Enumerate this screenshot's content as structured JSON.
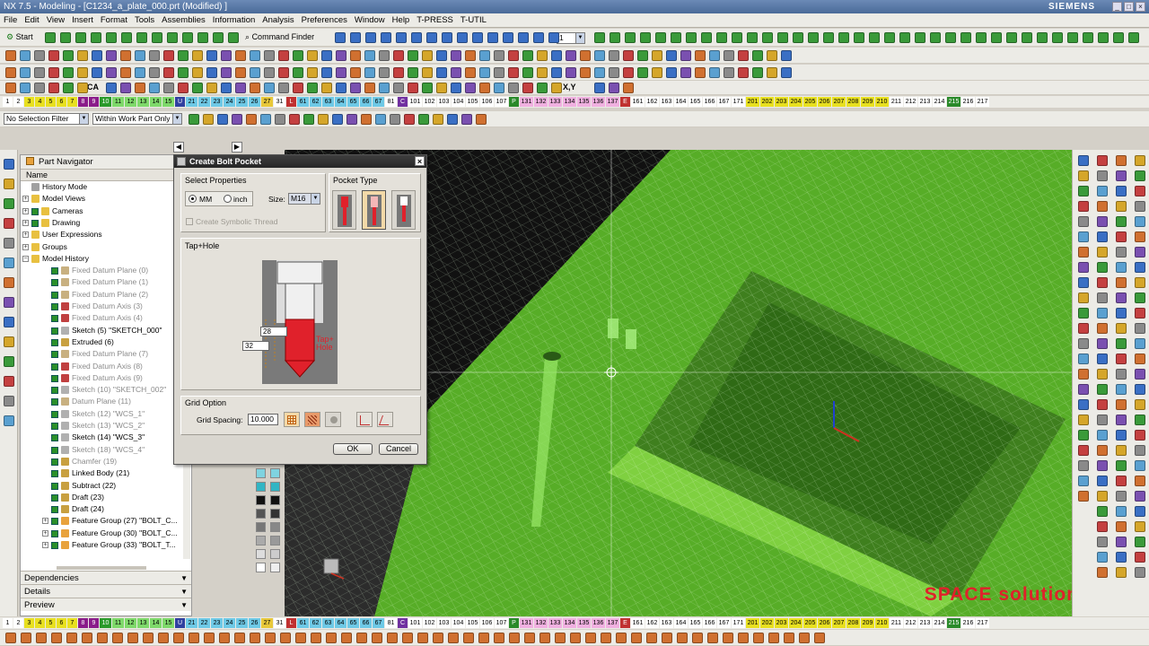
{
  "window": {
    "title": "NX 7.5 - Modeling - [C1234_a_plate_000.prt (Modified) ]",
    "brand": "SIEMENS"
  },
  "menu": [
    "File",
    "Edit",
    "View",
    "Insert",
    "Format",
    "Tools",
    "Assemblies",
    "Information",
    "Analysis",
    "Preferences",
    "Window",
    "Help",
    "T-PRESS",
    "T-UTIL"
  ],
  "toolbar": {
    "start_label": "Start",
    "command_finder_label": "Command Finder",
    "layer_value": "1",
    "ca_label": "CA",
    "xy_label": "X,Y"
  },
  "layer_strip": {
    "top": [
      {
        "t": "1",
        "c": "#ffffff"
      },
      {
        "t": "2",
        "c": "#ffffff"
      },
      {
        "t": "3",
        "c": "#e8e020"
      },
      {
        "t": "4",
        "c": "#e8e020"
      },
      {
        "t": "5",
        "c": "#e8e020"
      },
      {
        "t": "6",
        "c": "#e8e020"
      },
      {
        "t": "7",
        "c": "#e8e020"
      },
      {
        "t": "8",
        "c": "#8a1c8a"
      },
      {
        "t": "9",
        "c": "#8a1c8a"
      },
      {
        "t": "10",
        "c": "#2a9a2a"
      },
      {
        "t": "11",
        "c": "#7ed96a"
      },
      {
        "t": "12",
        "c": "#7ed96a"
      },
      {
        "t": "13",
        "c": "#7ed96a"
      },
      {
        "t": "14",
        "c": "#7ed96a"
      },
      {
        "t": "15",
        "c": "#7ed96a"
      },
      {
        "t": "U",
        "c": "#3040a0"
      },
      {
        "t": "21",
        "c": "#6ec9e6"
      },
      {
        "t": "22",
        "c": "#6ec9e6"
      },
      {
        "t": "23",
        "c": "#6ec9e6"
      },
      {
        "t": "24",
        "c": "#6ec9e6"
      },
      {
        "t": "25",
        "c": "#6ec9e6"
      },
      {
        "t": "26",
        "c": "#6ec9e6"
      },
      {
        "t": "27",
        "c": "#e8c83a"
      },
      {
        "t": "31",
        "c": "#ffffff"
      },
      {
        "t": "L",
        "c": "#c03030"
      },
      {
        "t": "61",
        "c": "#6ec9e6"
      },
      {
        "t": "62",
        "c": "#6ec9e6"
      },
      {
        "t": "63",
        "c": "#6ec9e6"
      },
      {
        "t": "64",
        "c": "#6ec9e6"
      },
      {
        "t": "65",
        "c": "#6ec9e6"
      },
      {
        "t": "66",
        "c": "#6ec9e6"
      },
      {
        "t": "67",
        "c": "#6ec9e6"
      },
      {
        "t": "81",
        "c": "#ffffff"
      },
      {
        "t": "C",
        "c": "#7030a0"
      },
      {
        "t": "101",
        "c": "#ffffff"
      },
      {
        "t": "102",
        "c": "#ffffff"
      },
      {
        "t": "103",
        "c": "#ffffff"
      },
      {
        "t": "104",
        "c": "#ffffff"
      },
      {
        "t": "105",
        "c": "#ffffff"
      },
      {
        "t": "106",
        "c": "#ffffff"
      },
      {
        "t": "107",
        "c": "#ffffff"
      },
      {
        "t": "P",
        "c": "#2a8a2a"
      },
      {
        "t": "131",
        "c": "#f0b0e0"
      },
      {
        "t": "132",
        "c": "#f0b0e0"
      },
      {
        "t": "133",
        "c": "#f0b0e0"
      },
      {
        "t": "134",
        "c": "#f0b0e0"
      },
      {
        "t": "135",
        "c": "#f0b0e0"
      },
      {
        "t": "136",
        "c": "#f0b0e0"
      },
      {
        "t": "137",
        "c": "#f0b0e0"
      },
      {
        "t": "E",
        "c": "#c03030"
      },
      {
        "t": "161",
        "c": "#ffffff"
      },
      {
        "t": "162",
        "c": "#ffffff"
      },
      {
        "t": "163",
        "c": "#ffffff"
      },
      {
        "t": "164",
        "c": "#ffffff"
      },
      {
        "t": "165",
        "c": "#ffffff"
      },
      {
        "t": "166",
        "c": "#ffffff"
      },
      {
        "t": "167",
        "c": "#ffffff"
      },
      {
        "t": "171",
        "c": "#ffffff"
      },
      {
        "t": "201",
        "c": "#e8e020"
      },
      {
        "t": "202",
        "c": "#e8e020"
      },
      {
        "t": "203",
        "c": "#e8e020"
      },
      {
        "t": "204",
        "c": "#e8e020"
      },
      {
        "t": "205",
        "c": "#e8e020"
      },
      {
        "t": "206",
        "c": "#e8e020"
      },
      {
        "t": "207",
        "c": "#e8e020"
      },
      {
        "t": "208",
        "c": "#e8e020"
      },
      {
        "t": "209",
        "c": "#e8e020"
      },
      {
        "t": "210",
        "c": "#e8e020"
      },
      {
        "t": "211",
        "c": "#ffffff"
      },
      {
        "t": "212",
        "c": "#ffffff"
      },
      {
        "t": "213",
        "c": "#ffffff"
      },
      {
        "t": "214",
        "c": "#ffffff"
      },
      {
        "t": "215",
        "c": "#2a8a2a"
      },
      {
        "t": "216",
        "c": "#ffffff"
      },
      {
        "t": "217",
        "c": "#ffffff"
      }
    ],
    "bottom": [
      {
        "t": "1",
        "c": "#ffffff"
      },
      {
        "t": "2",
        "c": "#ffffff"
      },
      {
        "t": "3",
        "c": "#e8e020"
      },
      {
        "t": "4",
        "c": "#e8e020"
      },
      {
        "t": "5",
        "c": "#e8e020"
      },
      {
        "t": "6",
        "c": "#e8e020"
      },
      {
        "t": "7",
        "c": "#e8e020"
      },
      {
        "t": "8",
        "c": "#8a1c8a"
      },
      {
        "t": "9",
        "c": "#8a1c8a"
      },
      {
        "t": "10",
        "c": "#2a9a2a"
      },
      {
        "t": "11",
        "c": "#7ed96a"
      },
      {
        "t": "12",
        "c": "#7ed96a"
      },
      {
        "t": "13",
        "c": "#7ed96a"
      },
      {
        "t": "14",
        "c": "#7ed96a"
      },
      {
        "t": "15",
        "c": "#7ed96a"
      },
      {
        "t": "U",
        "c": "#3040a0"
      },
      {
        "t": "21",
        "c": "#6ec9e6"
      },
      {
        "t": "22",
        "c": "#6ec9e6"
      },
      {
        "t": "23",
        "c": "#6ec9e6"
      },
      {
        "t": "24",
        "c": "#6ec9e6"
      },
      {
        "t": "25",
        "c": "#6ec9e6"
      },
      {
        "t": "26",
        "c": "#6ec9e6"
      },
      {
        "t": "27",
        "c": "#e8c83a"
      },
      {
        "t": "31",
        "c": "#ffffff"
      },
      {
        "t": "L",
        "c": "#c03030"
      },
      {
        "t": "61",
        "c": "#6ec9e6"
      },
      {
        "t": "62",
        "c": "#6ec9e6"
      },
      {
        "t": "63",
        "c": "#6ec9e6"
      },
      {
        "t": "64",
        "c": "#6ec9e6"
      },
      {
        "t": "65",
        "c": "#6ec9e6"
      },
      {
        "t": "66",
        "c": "#6ec9e6"
      },
      {
        "t": "67",
        "c": "#6ec9e6"
      },
      {
        "t": "81",
        "c": "#ffffff"
      },
      {
        "t": "C",
        "c": "#7030a0"
      },
      {
        "t": "101",
        "c": "#ffffff"
      },
      {
        "t": "102",
        "c": "#ffffff"
      },
      {
        "t": "103",
        "c": "#ffffff"
      },
      {
        "t": "104",
        "c": "#ffffff"
      },
      {
        "t": "105",
        "c": "#ffffff"
      },
      {
        "t": "106",
        "c": "#ffffff"
      },
      {
        "t": "107",
        "c": "#ffffff"
      },
      {
        "t": "P",
        "c": "#2a8a2a"
      },
      {
        "t": "131",
        "c": "#f0b0e0"
      },
      {
        "t": "132",
        "c": "#f0b0e0"
      },
      {
        "t": "133",
        "c": "#f0b0e0"
      },
      {
        "t": "134",
        "c": "#f0b0e0"
      },
      {
        "t": "135",
        "c": "#f0b0e0"
      },
      {
        "t": "136",
        "c": "#f0b0e0"
      },
      {
        "t": "137",
        "c": "#f0b0e0"
      },
      {
        "t": "E",
        "c": "#c03030"
      },
      {
        "t": "161",
        "c": "#ffffff"
      },
      {
        "t": "162",
        "c": "#ffffff"
      },
      {
        "t": "163",
        "c": "#ffffff"
      },
      {
        "t": "164",
        "c": "#ffffff"
      },
      {
        "t": "165",
        "c": "#ffffff"
      },
      {
        "t": "166",
        "c": "#ffffff"
      },
      {
        "t": "167",
        "c": "#ffffff"
      },
      {
        "t": "171",
        "c": "#ffffff"
      },
      {
        "t": "201",
        "c": "#e8e020"
      },
      {
        "t": "202",
        "c": "#e8e020"
      },
      {
        "t": "203",
        "c": "#e8e020"
      },
      {
        "t": "204",
        "c": "#e8e020"
      },
      {
        "t": "205",
        "c": "#e8e020"
      },
      {
        "t": "206",
        "c": "#e8e020"
      },
      {
        "t": "207",
        "c": "#e8e020"
      },
      {
        "t": "208",
        "c": "#e8e020"
      },
      {
        "t": "209",
        "c": "#e8e020"
      },
      {
        "t": "210",
        "c": "#e8e020"
      },
      {
        "t": "211",
        "c": "#ffffff"
      },
      {
        "t": "212",
        "c": "#ffffff"
      },
      {
        "t": "213",
        "c": "#ffffff"
      },
      {
        "t": "214",
        "c": "#ffffff"
      },
      {
        "t": "215",
        "c": "#2a8a2a"
      },
      {
        "t": "216",
        "c": "#ffffff"
      },
      {
        "t": "217",
        "c": "#ffffff"
      }
    ]
  },
  "selection": {
    "filter": "No Selection Filter",
    "scope": "Within Work Part Only"
  },
  "navigator": {
    "title": "Part Navigator",
    "column": "Name",
    "items": [
      {
        "label": "History Mode",
        "kind": "mode",
        "dim": false,
        "checked": false
      },
      {
        "label": "Model Views",
        "kind": "folder",
        "dim": false,
        "checked": false,
        "expander": "+"
      },
      {
        "label": "Cameras",
        "kind": "folder",
        "dim": false,
        "checked": true,
        "expander": "+"
      },
      {
        "label": "Drawing",
        "kind": "folder",
        "dim": false,
        "checked": true,
        "expander": "+"
      },
      {
        "label": "User Expressions",
        "kind": "folder",
        "dim": false,
        "checked": false,
        "expander": "+"
      },
      {
        "label": "Groups",
        "kind": "folder",
        "dim": false,
        "checked": false,
        "expander": "+"
      },
      {
        "label": "Model History",
        "kind": "folder",
        "dim": false,
        "checked": false,
        "expander": "−"
      },
      {
        "label": "Fixed Datum Plane (0)",
        "kind": "datum",
        "dim": true,
        "checked": true
      },
      {
        "label": "Fixed Datum Plane (1)",
        "kind": "datum",
        "dim": true,
        "checked": true
      },
      {
        "label": "Fixed Datum Plane (2)",
        "kind": "datum",
        "dim": true,
        "checked": true
      },
      {
        "label": "Fixed Datum Axis (3)",
        "kind": "axis",
        "dim": true,
        "checked": true
      },
      {
        "label": "Fixed Datum Axis (4)",
        "kind": "axis",
        "dim": true,
        "checked": true
      },
      {
        "label": "Sketch (5) \"SKETCH_000\"",
        "kind": "sketch",
        "dim": false,
        "checked": true
      },
      {
        "label": "Extruded (6)",
        "kind": "feature",
        "dim": false,
        "checked": true
      },
      {
        "label": "Fixed Datum Plane (7)",
        "kind": "datum",
        "dim": true,
        "checked": true
      },
      {
        "label": "Fixed Datum Axis (8)",
        "kind": "axis",
        "dim": true,
        "checked": true
      },
      {
        "label": "Fixed Datum Axis (9)",
        "kind": "axis",
        "dim": true,
        "checked": true
      },
      {
        "label": "Sketch (10) \"SKETCH_002\"",
        "kind": "sketch",
        "dim": true,
        "checked": true
      },
      {
        "label": "Datum Plane (11)",
        "kind": "datum",
        "dim": true,
        "checked": true
      },
      {
        "label": "Sketch (12) \"WCS_1\"",
        "kind": "sketch",
        "dim": true,
        "checked": true
      },
      {
        "label": "Sketch (13) \"WCS_2\"",
        "kind": "sketch",
        "dim": true,
        "checked": true
      },
      {
        "label": "Sketch (14) \"WCS_3\"",
        "kind": "sketch",
        "dim": false,
        "checked": true
      },
      {
        "label": "Sketch (18) \"WCS_4\"",
        "kind": "sketch",
        "dim": true,
        "checked": true
      },
      {
        "label": "Chamfer (19)",
        "kind": "feature",
        "dim": true,
        "checked": true
      },
      {
        "label": "Linked Body (21)",
        "kind": "feature",
        "dim": false,
        "checked": true
      },
      {
        "label": "Subtract (22)",
        "kind": "feature",
        "dim": false,
        "checked": true
      },
      {
        "label": "Draft (23)",
        "kind": "feature",
        "dim": false,
        "checked": true
      },
      {
        "label": "Draft (24)",
        "kind": "feature",
        "dim": false,
        "checked": true
      },
      {
        "label": "Feature Group (27) \"BOLT_C...",
        "kind": "group",
        "dim": false,
        "checked": true,
        "expander": "+"
      },
      {
        "label": "Feature Group (30) \"BOLT_C...",
        "kind": "group",
        "dim": false,
        "checked": true,
        "expander": "+"
      },
      {
        "label": "Feature Group (33) \"BOLT_T...",
        "kind": "group",
        "dim": false,
        "checked": true,
        "expander": "+"
      }
    ],
    "sections": [
      "Dependencies",
      "Details",
      "Preview"
    ]
  },
  "dialog": {
    "title": "Create Bolt Pocket",
    "select_properties": "Select Properties",
    "unit_mm": "MM",
    "unit_inch": "inch",
    "size_label": "Size:",
    "size_value": "M16",
    "symbolic_thread": "Create Symbolic Thread",
    "pocket_type": "Pocket Type",
    "preview_title": "Tap+Hole",
    "dim_upper": "28",
    "dim_lower": "32",
    "callout_line1": "Tap+",
    "callout_line2": "Hole",
    "grid_option": "Grid Option",
    "grid_spacing_label": "Grid Spacing:",
    "grid_spacing_value": "10.000",
    "ok": "OK",
    "cancel": "Cancel"
  },
  "watermark": "SPACE solution",
  "colors": {
    "viewport_green": "#5cb52a",
    "accent_red": "#e0212b",
    "dialog_title_bg": "#2f2f2f"
  }
}
